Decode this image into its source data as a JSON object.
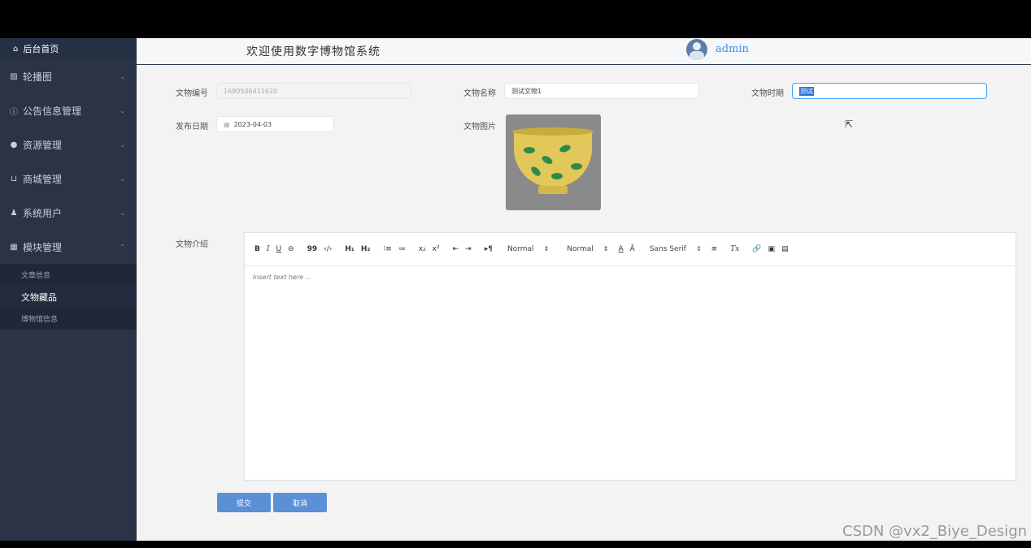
{
  "sidebar": {
    "home": "后台首页",
    "items": [
      {
        "label": "轮播图",
        "icon": "image-icon"
      },
      {
        "label": "公告信息管理",
        "icon": "info-circle-icon"
      },
      {
        "label": "资源管理",
        "icon": "bulb-icon"
      },
      {
        "label": "商城管理",
        "icon": "cart-icon"
      },
      {
        "label": "系统用户",
        "icon": "user-icon"
      },
      {
        "label": "模块管理",
        "icon": "grid-icon"
      }
    ],
    "submenu": [
      {
        "label": "文章信息"
      },
      {
        "label": "文物藏品"
      },
      {
        "label": "博物馆信息"
      }
    ]
  },
  "header": {
    "title": "欢迎使用数字博物馆系统",
    "user": "admin"
  },
  "form": {
    "id_label": "文物编号",
    "id_value": "1680506411620",
    "name_label": "文物名称",
    "name_value": "测试文物1",
    "period_label": "文物时期",
    "period_value": "测试",
    "date_label": "发布日期",
    "date_value": "2023-04-03",
    "image_label": "文物图片",
    "intro_label": "文物介绍"
  },
  "editor": {
    "toolbar": {
      "bold": "B",
      "italic": "I",
      "underline": "U",
      "strike": "⊖",
      "quote": "99",
      "code": "‹/›",
      "h1": "H₁",
      "h2": "H₂",
      "ordered": "⁝≡",
      "bullet": "≔",
      "sub": "x₂",
      "sup": "x²",
      "outdent": "⇤",
      "indent": "⇥",
      "direction": "▸¶",
      "size_picker": "Normal",
      "header_picker": "Normal",
      "color": "A",
      "background": "Ā",
      "font_picker": "Sans Serif",
      "align": "≡",
      "clean": "Tx",
      "link": "🔗",
      "image": "▣",
      "video": "▤"
    },
    "placeholder": "Insert text here ..."
  },
  "buttons": {
    "submit": "提交",
    "cancel": "取消"
  },
  "watermark": "CSDN @vx2_Biye_Design"
}
